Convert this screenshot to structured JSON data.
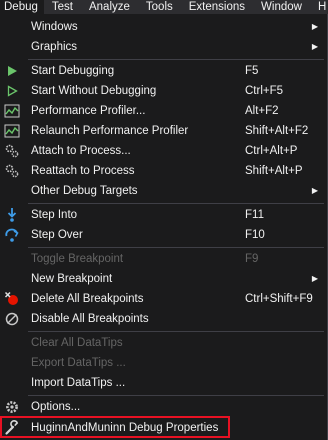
{
  "menubar": {
    "items": [
      "Debug",
      "Test",
      "Analyze",
      "Tools",
      "Extensions",
      "Window",
      "H"
    ]
  },
  "menu": {
    "items": [
      {
        "label": "Windows",
        "shortcut": "",
        "submenu": true,
        "icon": "",
        "disabled": false
      },
      {
        "label": "Graphics",
        "shortcut": "",
        "submenu": true,
        "icon": "",
        "disabled": false
      },
      {
        "label": "Start Debugging",
        "shortcut": "F5",
        "submenu": false,
        "icon": "play-filled-icon",
        "disabled": false
      },
      {
        "label": "Start Without Debugging",
        "shortcut": "Ctrl+F5",
        "submenu": false,
        "icon": "play-outline-icon",
        "disabled": false
      },
      {
        "label": "Performance Profiler...",
        "shortcut": "Alt+F2",
        "submenu": false,
        "icon": "performance-chart-icon",
        "disabled": false
      },
      {
        "label": "Relaunch Performance Profiler",
        "shortcut": "Shift+Alt+F2",
        "submenu": false,
        "icon": "performance-chart-icon",
        "disabled": false
      },
      {
        "label": "Attach to Process...",
        "shortcut": "Ctrl+Alt+P",
        "submenu": false,
        "icon": "gears-icon",
        "disabled": false
      },
      {
        "label": "Reattach to Process",
        "shortcut": "Shift+Alt+P",
        "submenu": false,
        "icon": "gears-icon",
        "disabled": false
      },
      {
        "label": "Other Debug Targets",
        "shortcut": "",
        "submenu": true,
        "icon": "",
        "disabled": false
      },
      {
        "label": "Step Into",
        "shortcut": "F11",
        "submenu": false,
        "icon": "step-into-icon",
        "disabled": false
      },
      {
        "label": "Step Over",
        "shortcut": "F10",
        "submenu": false,
        "icon": "step-over-icon",
        "disabled": false
      },
      {
        "label": "Toggle Breakpoint",
        "shortcut": "F9",
        "submenu": false,
        "icon": "",
        "disabled": true
      },
      {
        "label": "New Breakpoint",
        "shortcut": "",
        "submenu": true,
        "icon": "",
        "disabled": false
      },
      {
        "label": "Delete All Breakpoints",
        "shortcut": "Ctrl+Shift+F9",
        "submenu": false,
        "icon": "delete-breakpoints-icon",
        "disabled": false
      },
      {
        "label": "Disable All Breakpoints",
        "shortcut": "",
        "submenu": false,
        "icon": "disable-breakpoints-icon",
        "disabled": false
      },
      {
        "label": "Clear All DataTips",
        "shortcut": "",
        "submenu": false,
        "icon": "",
        "disabled": true
      },
      {
        "label": "Export DataTips ...",
        "shortcut": "",
        "submenu": false,
        "icon": "",
        "disabled": true
      },
      {
        "label": "Import DataTips ...",
        "shortcut": "",
        "submenu": false,
        "icon": "",
        "disabled": false
      },
      {
        "label": "Options...",
        "shortcut": "",
        "submenu": false,
        "icon": "gear-icon",
        "disabled": false
      },
      {
        "label": "HuginnAndMuninn Debug Properties",
        "shortcut": "",
        "submenu": false,
        "icon": "wrench-icon",
        "disabled": false
      }
    ]
  },
  "colors": {
    "menu_bg": "#1b1b1c",
    "menubar_bg": "#2d2d30",
    "text": "#f1f1f1",
    "disabled_text": "#656565",
    "separator": "#3f3f46",
    "play_green": "#6bc56b",
    "step_blue": "#3e9ce8",
    "breakpoint_red": "#e51400",
    "highlight_red": "#e81123"
  }
}
